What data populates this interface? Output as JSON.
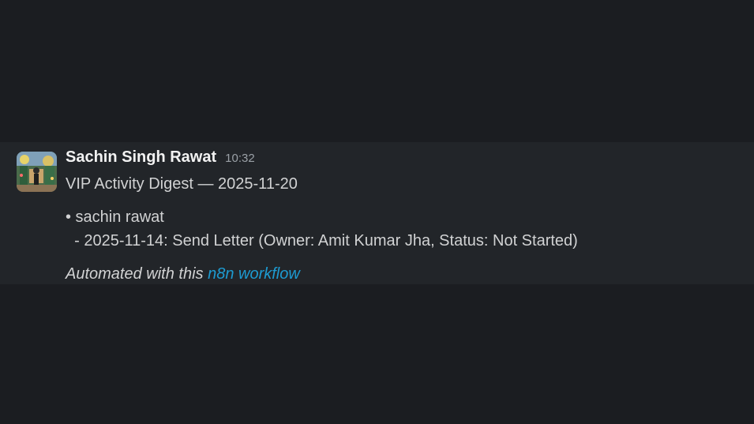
{
  "message": {
    "sender": "Sachin Singh Rawat",
    "time": "10:32",
    "title": "VIP Activity Digest — 2025-11-20",
    "bullet": "• sachin rawat",
    "item": "  - 2025-11-14: Send Letter (Owner: Amit Kumar Jha, Status: Not Started)",
    "footer_prefix": "Automated with this ",
    "footer_link": "n8n workflow"
  },
  "colors": {
    "background": "#1b1d21",
    "message_background": "#222529",
    "link": "#1d9bd1"
  }
}
